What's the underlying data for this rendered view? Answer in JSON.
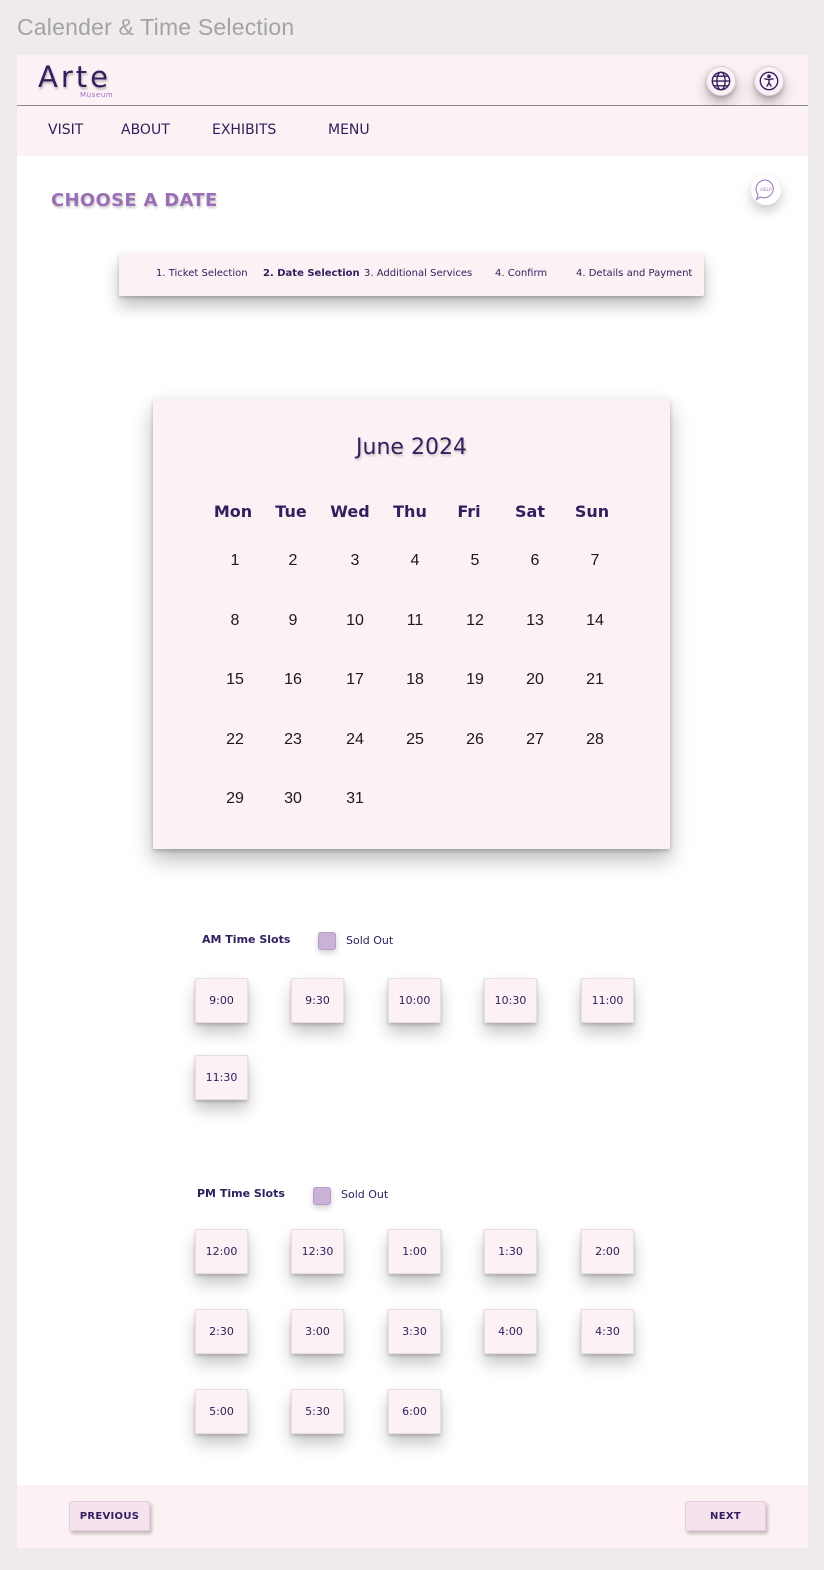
{
  "frame_title": "Calender & Time Selection",
  "brand": {
    "name": "Arte",
    "sub": "Museum"
  },
  "header_icons": [
    "globe-icon",
    "accessibility-icon"
  ],
  "nav": {
    "items": [
      "VISIT",
      "ABOUT",
      "EXHIBITS",
      "MENU"
    ]
  },
  "help": {
    "label": "HELP"
  },
  "page_heading": "CHOOSE A DATE",
  "steps": [
    {
      "label": "1. Ticket Selection",
      "active": false
    },
    {
      "label": "2. Date Selection",
      "active": true
    },
    {
      "label": "3. Additional Services",
      "active": false
    },
    {
      "label": "4. Confirm",
      "active": false
    },
    {
      "label": "4. Details and Payment",
      "active": false
    }
  ],
  "calendar": {
    "month_label": "June 2024",
    "weekdays": [
      "Mon",
      "Tue",
      "Wed",
      "Thu",
      "Fri",
      "Sat",
      "Sun"
    ],
    "weeks": [
      [
        "1",
        "2",
        "3",
        "4",
        "5",
        "6",
        "7"
      ],
      [
        "8",
        "9",
        "10",
        "11",
        "12",
        "13",
        "14"
      ],
      [
        "15",
        "16",
        "17",
        "18",
        "19",
        "20",
        "21"
      ],
      [
        "22",
        "23",
        "24",
        "25",
        "26",
        "27",
        "28"
      ],
      [
        "29",
        "30",
        "31"
      ]
    ]
  },
  "am_slots": {
    "heading": "AM Time Slots",
    "legend": "Sold Out",
    "times": [
      "9:00",
      "9:30",
      "10:00",
      "10:30",
      "11:00",
      "11:30"
    ]
  },
  "pm_slots": {
    "heading": "PM Time Slots",
    "legend": "Sold Out",
    "times": [
      "12:00",
      "12:30",
      "1:00",
      "1:30",
      "2:00",
      "2:30",
      "3:00",
      "3:30",
      "4:00",
      "4:30",
      "5:00",
      "5:30",
      "6:00"
    ]
  },
  "footer": {
    "previous": "PREVIOUS",
    "next": "NEXT"
  },
  "colors": {
    "primary": "#30205e",
    "accent": "#9b6fb5",
    "panel": "#fcf2f5",
    "sold_out": "#c8b2d6",
    "backdrop": "#efebeb"
  }
}
